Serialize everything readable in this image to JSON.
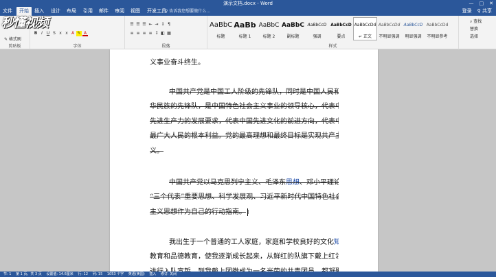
{
  "title_bar": {
    "title": "演示文档.docx - Word",
    "controls": [
      "—",
      "□",
      "✕"
    ]
  },
  "tabs": [
    "文件",
    "开始",
    "插入",
    "设计",
    "布局",
    "引用",
    "邮件",
    "审阅",
    "视图",
    "开发工具"
  ],
  "tell_me": "♀ 告诉我您想要做什么...",
  "account": {
    "login": "登录",
    "share": "♀ 共享"
  },
  "logo_text": "秒懂视频",
  "ribbon": {
    "clipboard": {
      "format_painter": "✎ 格式刷",
      "label": "剪贴板"
    },
    "font": {
      "label": "字体"
    },
    "paragraph": {
      "label": "段落"
    },
    "styles": {
      "label": "样式",
      "items": [
        {
          "sample": "AaBbC",
          "name": "标题"
        },
        {
          "sample": "AaBb",
          "name": "标题 1"
        },
        {
          "sample": "AaBbC",
          "name": "标题 2"
        },
        {
          "sample": "AaBbC",
          "name": "副标题"
        },
        {
          "sample": "AaBbCcD",
          "name": "强调"
        },
        {
          "sample": "AaBbCcD",
          "name": "要点"
        },
        {
          "sample": "AaBbCcDd",
          "name": "↵ 正文"
        },
        {
          "sample": "AaBbCcDd",
          "name": "不明显强调"
        },
        {
          "sample": "AaBbCcD",
          "name": "明显强调"
        },
        {
          "sample": "AaBbCcDd",
          "name": "不明显参考"
        }
      ]
    },
    "editing": {
      "find": "⌕ 查找",
      "replace": "替换",
      "select": "选择"
    }
  },
  "document": {
    "top_fragment": "义事业奋斗终生。",
    "para1": [
      "中国共产党是中国工人阶级的先锋队，同时是中国人民和中",
      "华民族的先锋队，是中国特色社会主义事业的领导核心，代表中国",
      "先进生产力的发展要求，代表中国先进文化的前进方向，代表中国",
      "最广大人民的根本利益。党的最高理想和最终目标是实现共产主",
      "义。"
    ],
    "para2_pre": "中国共产党以马克思列宁主义、毛泽东",
    "para2_link": "思想",
    "para2_post": "、邓小平理论、",
    "para2_rest": [
      "“三个代表”重要思想、科学发展观、习近平新时代中国特色社会",
      "主义思想作为自己的行动指南。"
    ],
    "para3_pre": "我出生于一个普通的工人家庭，家庭和学校良好的文化",
    "para3_link": "知识",
    "para3_rest": [
      "教育和品德教育，使我逐渐成长起来，从鲜红的队旗下戴上红领巾",
      "进行入队宣誓，到我戴上团徽成为一名光荣的共青团员，都凝聚着"
    ]
  },
  "status_bar": [
    "节: 1",
    "第 1 页，共 3 页",
    "设置值: 14.6厘米",
    "行: 12",
    "列: 15",
    "1053 个字",
    "英语(美国)",
    "插入",
    "修订: 关闭"
  ]
}
